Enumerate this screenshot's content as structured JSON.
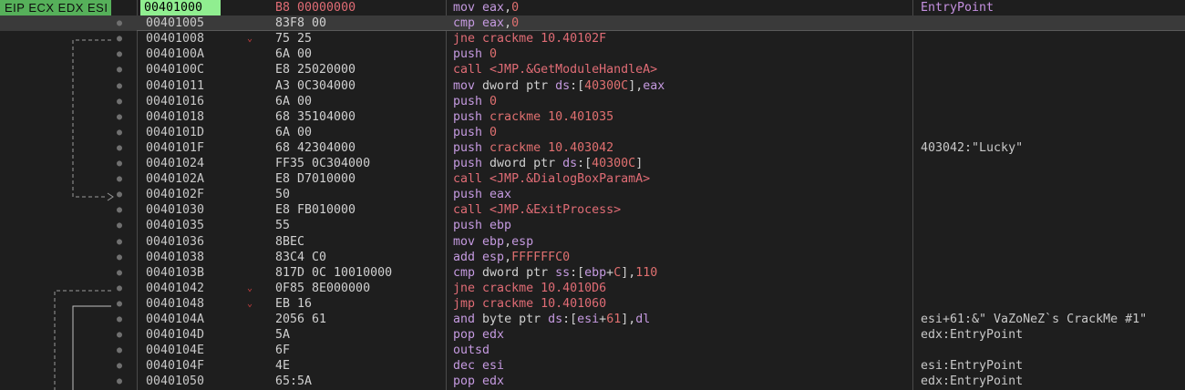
{
  "register_labels": "EIP ECX EDX ESI",
  "colors": {
    "background": "#1e1e1e",
    "eip_highlight": "#90ee90",
    "register_tag": "#56b05a",
    "mnemonic": "#c59ae0",
    "call_jump": "#e06c75",
    "immediate": "#e07070",
    "comment_entry": "#c590e0"
  },
  "rows": [
    {
      "addr": "00401000",
      "bytes": "B8 00000000",
      "mn": "mov",
      "ops": [
        [
          "reg",
          "eax"
        ],
        [
          "txt",
          ","
        ],
        [
          "imm",
          "0"
        ]
      ],
      "comment": "EntryPoint",
      "eip": true
    },
    {
      "addr": "00401005",
      "bytes": "83F8 00",
      "mn": "cmp",
      "ops": [
        [
          "reg",
          "eax"
        ],
        [
          "txt",
          ","
        ],
        [
          "imm",
          "0"
        ]
      ],
      "comment": "",
      "selected": true
    },
    {
      "addr": "00401008",
      "bytes": "75 25",
      "mn": "jne",
      "ops": [
        [
          "tgt",
          "crackme 10.40102F"
        ]
      ],
      "comment": "",
      "arrow": true
    },
    {
      "addr": "0040100A",
      "bytes": "6A 00",
      "mn": "push",
      "ops": [
        [
          "imm",
          "0"
        ]
      ],
      "comment": ""
    },
    {
      "addr": "0040100C",
      "bytes": "E8 25020000",
      "mn": "call",
      "ops": [
        [
          "tgt",
          "<JMP.&GetModuleHandleA>"
        ]
      ],
      "comment": ""
    },
    {
      "addr": "00401011",
      "bytes": "A3 0C304000",
      "mn": "mov",
      "ops": [
        [
          "txt",
          "dword ptr "
        ],
        [
          "seg",
          "ds"
        ],
        [
          "txt",
          ":["
        ],
        [
          "imm",
          "40300C"
        ],
        [
          "txt",
          "],"
        ],
        [
          "reg",
          "eax"
        ]
      ],
      "comment": ""
    },
    {
      "addr": "00401016",
      "bytes": "6A 00",
      "mn": "push",
      "ops": [
        [
          "imm",
          "0"
        ]
      ],
      "comment": ""
    },
    {
      "addr": "00401018",
      "bytes": "68 35104000",
      "mn": "push",
      "ops": [
        [
          "imm",
          "crackme 10.401035"
        ]
      ],
      "comment": ""
    },
    {
      "addr": "0040101D",
      "bytes": "6A 00",
      "mn": "push",
      "ops": [
        [
          "imm",
          "0"
        ]
      ],
      "comment": ""
    },
    {
      "addr": "0040101F",
      "bytes": "68 42304000",
      "mn": "push",
      "ops": [
        [
          "imm",
          "crackme 10.403042"
        ]
      ],
      "comment": "403042:\"Lucky\""
    },
    {
      "addr": "00401024",
      "bytes": "FF35 0C304000",
      "mn": "push",
      "ops": [
        [
          "txt",
          "dword ptr "
        ],
        [
          "seg",
          "ds"
        ],
        [
          "txt",
          ":["
        ],
        [
          "imm",
          "40300C"
        ],
        [
          "txt",
          "]"
        ]
      ],
      "comment": ""
    },
    {
      "addr": "0040102A",
      "bytes": "E8 D7010000",
      "mn": "call",
      "ops": [
        [
          "tgt",
          "<JMP.&DialogBoxParamA>"
        ]
      ],
      "comment": ""
    },
    {
      "addr": "0040102F",
      "bytes": "50",
      "mn": "push",
      "ops": [
        [
          "reg",
          "eax"
        ]
      ],
      "comment": ""
    },
    {
      "addr": "00401030",
      "bytes": "E8 FB010000",
      "mn": "call",
      "ops": [
        [
          "tgt",
          "<JMP.&ExitProcess>"
        ]
      ],
      "comment": ""
    },
    {
      "addr": "00401035",
      "bytes": "55",
      "mn": "push",
      "ops": [
        [
          "reg",
          "ebp"
        ]
      ],
      "comment": ""
    },
    {
      "addr": "00401036",
      "bytes": "8BEC",
      "mn": "mov",
      "ops": [
        [
          "reg",
          "ebp"
        ],
        [
          "txt",
          ","
        ],
        [
          "reg",
          "esp"
        ]
      ],
      "comment": ""
    },
    {
      "addr": "00401038",
      "bytes": "83C4 C0",
      "mn": "add",
      "ops": [
        [
          "reg",
          "esp"
        ],
        [
          "txt",
          ","
        ],
        [
          "imm",
          "FFFFFFC0"
        ]
      ],
      "comment": ""
    },
    {
      "addr": "0040103B",
      "bytes": "817D 0C 10010000",
      "mn": "cmp",
      "ops": [
        [
          "txt",
          "dword ptr "
        ],
        [
          "seg",
          "ss"
        ],
        [
          "txt",
          ":["
        ],
        [
          "reg",
          "ebp"
        ],
        [
          "txt",
          "+"
        ],
        [
          "imm",
          "C"
        ],
        [
          "txt",
          "],"
        ],
        [
          "imm",
          "110"
        ]
      ],
      "comment": ""
    },
    {
      "addr": "00401042",
      "bytes": "0F85 8E000000",
      "mn": "jne",
      "ops": [
        [
          "tgt",
          "crackme 10.4010D6"
        ]
      ],
      "comment": "",
      "arrow": true
    },
    {
      "addr": "00401048",
      "bytes": "EB 16",
      "mn": "jmp",
      "ops": [
        [
          "tgt",
          "crackme 10.401060"
        ]
      ],
      "comment": "",
      "arrow": true
    },
    {
      "addr": "0040104A",
      "bytes": "2056 61",
      "mn": "and",
      "ops": [
        [
          "txt",
          "byte ptr "
        ],
        [
          "seg",
          "ds"
        ],
        [
          "txt",
          ":["
        ],
        [
          "reg",
          "esi"
        ],
        [
          "txt",
          "+"
        ],
        [
          "imm",
          "61"
        ],
        [
          "txt",
          "],"
        ],
        [
          "reg",
          "dl"
        ]
      ],
      "comment": "esi+61:&\" VaZoNeZ`s CrackMe #1\""
    },
    {
      "addr": "0040104D",
      "bytes": "5A",
      "mn": "pop",
      "ops": [
        [
          "reg",
          "edx"
        ]
      ],
      "comment": "edx:EntryPoint"
    },
    {
      "addr": "0040104E",
      "bytes": "6F",
      "mn": "outsd",
      "ops": [],
      "comment": ""
    },
    {
      "addr": "0040104F",
      "bytes": "4E",
      "mn": "dec",
      "ops": [
        [
          "reg",
          "esi"
        ]
      ],
      "comment": "esi:EntryPoint"
    },
    {
      "addr": "00401050",
      "bytes": "65:5A",
      "mn": "pop",
      "ops": [
        [
          "reg",
          "edx"
        ]
      ],
      "comment": "edx:EntryPoint"
    }
  ]
}
